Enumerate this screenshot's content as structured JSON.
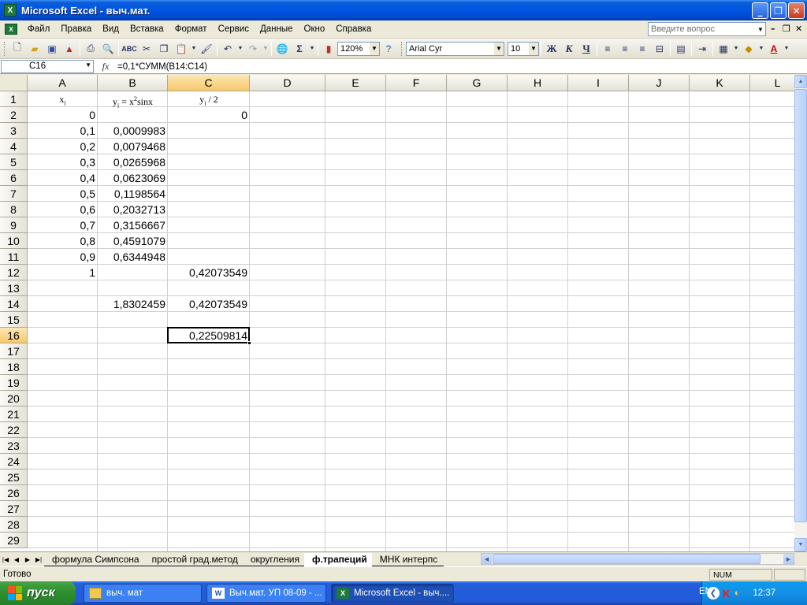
{
  "window": {
    "title": "Microsoft Excel - выч.мат.",
    "app_icon": "excel-icon"
  },
  "menu": {
    "items": [
      "Файл",
      "Правка",
      "Вид",
      "Вставка",
      "Формат",
      "Сервис",
      "Данные",
      "Окно",
      "Справка"
    ],
    "ask_placeholder": "Введите вопрос"
  },
  "toolbar": {
    "zoom": "120%",
    "font": "Arial Cyr",
    "font_size": "10",
    "bold": "Ж",
    "italic": "К",
    "underline": "Ч",
    "sum_glyph": "Σ"
  },
  "formula_bar": {
    "name_box": "C16",
    "fx": "fx",
    "formula": "=0,1*СУММ(B14:C14)"
  },
  "grid": {
    "columns": [
      "A",
      "B",
      "C",
      "D",
      "E",
      "F",
      "G",
      "H",
      "I",
      "J",
      "K",
      "L"
    ],
    "selected_column": "C",
    "rows": [
      "1",
      "2",
      "3",
      "4",
      "5",
      "6",
      "7",
      "8",
      "9",
      "10",
      "11",
      "12",
      "13",
      "14",
      "15",
      "16",
      "17",
      "18",
      "19",
      "20",
      "21",
      "22",
      "23",
      "24",
      "25",
      "26",
      "27",
      "28",
      "29"
    ],
    "selected_row": "16",
    "header_row": {
      "A": "xi",
      "B": "yi = x2sinx",
      "C": "yi / 2"
    },
    "values": {
      "A2": "0",
      "C2": "0",
      "A3": "0,1",
      "B3": "0,0009983",
      "A4": "0,2",
      "B4": "0,0079468",
      "A5": "0,3",
      "B5": "0,0265968",
      "A6": "0,4",
      "B6": "0,0623069",
      "A7": "0,5",
      "B7": "0,1198564",
      "A8": "0,6",
      "B8": "0,2032713",
      "A9": "0,7",
      "B9": "0,3156667",
      "A10": "0,8",
      "B10": "0,4591079",
      "A11": "0,9",
      "B11": "0,6344948",
      "A12": "1",
      "C12": "0,42073549",
      "B14": "1,8302459",
      "C14": "0,42073549",
      "C16": "0,22509814"
    }
  },
  "sheet_tabs": [
    "формула Симпсона",
    "простой град.метод",
    "округления",
    "ф.трапеций",
    "МНК интерпс"
  ],
  "active_tab": "ф.трапеций",
  "status": {
    "text": "Готово",
    "num": "NUM"
  },
  "taskbar": {
    "start": "пуск",
    "tasks": [
      {
        "label": "выч. мат",
        "icon": "folder-icon"
      },
      {
        "label": "Выч.мат. УП 08-09 - ...",
        "icon": "word-icon"
      },
      {
        "label": "Microsoft Excel - выч....",
        "icon": "excel-icon"
      }
    ],
    "lang": "EN",
    "clock": "12:37"
  },
  "colors": {
    "title_blue": "#0054e3",
    "selected_header": "#f7c86a",
    "start_green": "#2b8f2b",
    "taskbar_blue": "#245edb"
  }
}
